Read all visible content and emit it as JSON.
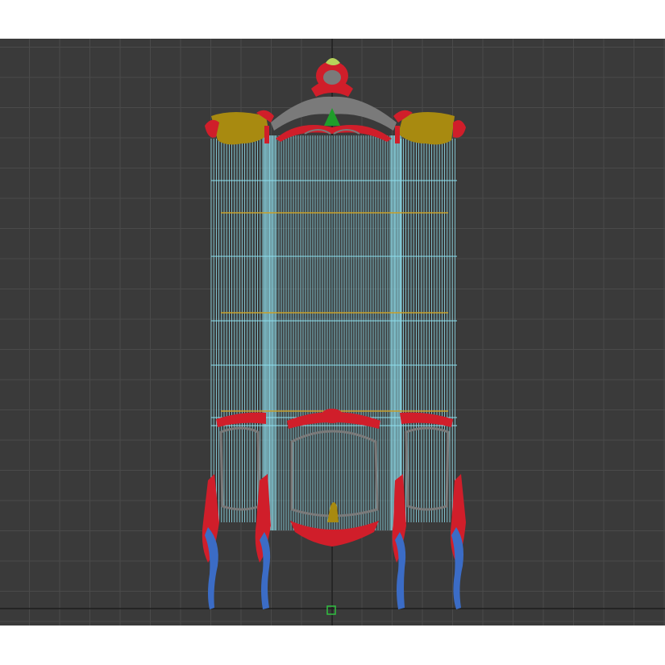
{
  "viewport": {
    "background_color": "#3a3a3a",
    "grid_color": "#4a4a4a",
    "axis_color": "#1c1c1c"
  },
  "model": {
    "wire_color": "#8fe0ef",
    "frame_red": "#d01e2a",
    "legs_blue": "#3b6cc6",
    "crest_yellow": "#a88a10",
    "shelf_yellow": "#c8a02a",
    "trim_gray": "#7a7a7a",
    "finial_green": "#1f9e2a",
    "top_ornament_green": "#b6d35a"
  },
  "gizmo": {
    "icon": "pivot-square-icon",
    "color": "#30c040"
  }
}
